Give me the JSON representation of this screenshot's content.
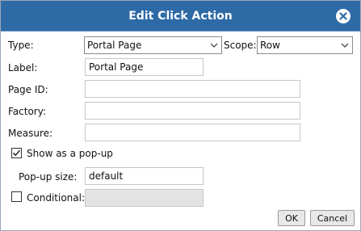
{
  "dialog": {
    "title": "Edit Click Action",
    "close_icon": "close-icon"
  },
  "form": {
    "type_label": "Type:",
    "type_value": "Portal Page",
    "scope_label": "Scope:",
    "scope_value": "Row",
    "label_label": "Label:",
    "label_value": "Portal Page",
    "page_id_label": "Page ID:",
    "page_id_value": "",
    "factory_label": "Factory:",
    "factory_value": "",
    "measure_label": "Measure:",
    "measure_value": "",
    "popup_label": "Show as a pop-up",
    "popup_checked": true,
    "popup_size_label": "Pop-up size:",
    "popup_size_value": "default",
    "conditional_label": "Conditional:",
    "conditional_checked": false,
    "conditional_value": ""
  },
  "buttons": {
    "ok_label": "OK",
    "cancel_label": "Cancel"
  },
  "colors": {
    "titlebar": "#2e6aa6",
    "disabled_field": "#e3e3e3"
  }
}
